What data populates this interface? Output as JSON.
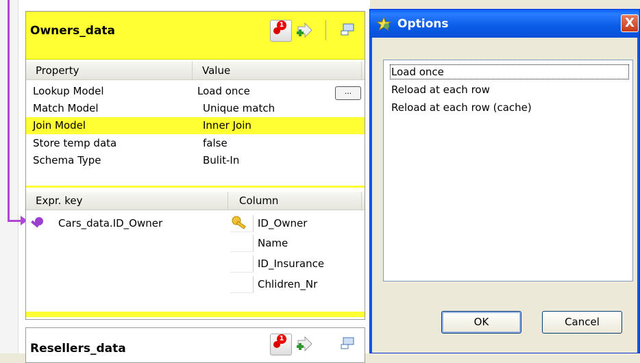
{
  "owners_panel": {
    "title": "Owners_data",
    "headers": {
      "property": "Property",
      "value": "Value"
    },
    "rows": [
      {
        "property": "Lookup Model",
        "value": "Load once"
      },
      {
        "property": "Match Model",
        "value": "Unique match"
      },
      {
        "property": "Join Model",
        "value": "Inner Join"
      },
      {
        "property": "Store temp data",
        "value": "false"
      },
      {
        "property": "Schema Type",
        "value": "Bulit-In"
      }
    ],
    "lookup_button_label": "...",
    "badge_count": "1",
    "key_headers": {
      "expr_key": "Expr. key",
      "column": "Column"
    },
    "key_expr": "Cars_data.ID_Owner",
    "columns": [
      "ID_Owner",
      "Name",
      "ID_Insurance",
      "Chlidren_Nr"
    ]
  },
  "resellers_panel": {
    "title": "Resellers_data",
    "badge_count": "1"
  },
  "options_dialog": {
    "title": "Options",
    "close_label": "X",
    "options": [
      "Load once",
      "Reload at each row",
      "Reload at each row (cache)"
    ],
    "ok_label": "OK",
    "cancel_label": "Cancel"
  },
  "colors": {
    "panel_yellow": "#ffff33",
    "link_purple": "#b045d6",
    "title_bar_blue": "#0a5be8",
    "close_red": "#c53a1a"
  },
  "icons": [
    "alert-lookup-icon",
    "add-join-icon",
    "minimize-panel-icon",
    "key-icon",
    "options-star-icon"
  ]
}
